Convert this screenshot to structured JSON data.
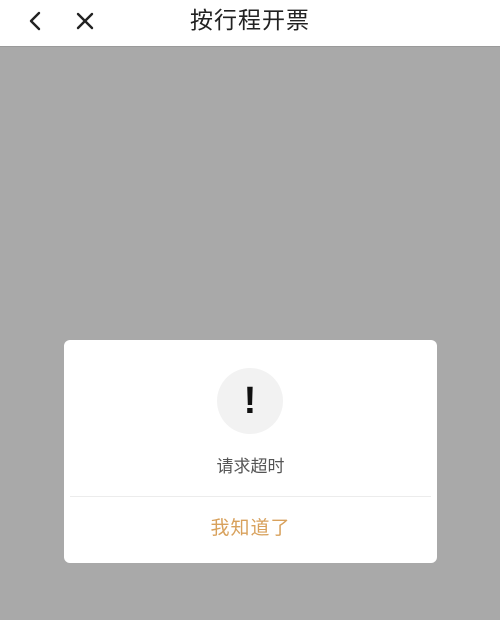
{
  "nav": {
    "title": "按行程开票",
    "back_icon": "chevron-left-icon",
    "close_icon": "close-icon"
  },
  "dialog": {
    "icon": "exclamation-icon",
    "icon_glyph": "!",
    "message": "请求超时",
    "confirm_label": "我知道了"
  },
  "colors": {
    "overlay": "#a9a9a9",
    "accent": "#d8a15c",
    "message_text": "#555555",
    "title_text": "#222222"
  }
}
